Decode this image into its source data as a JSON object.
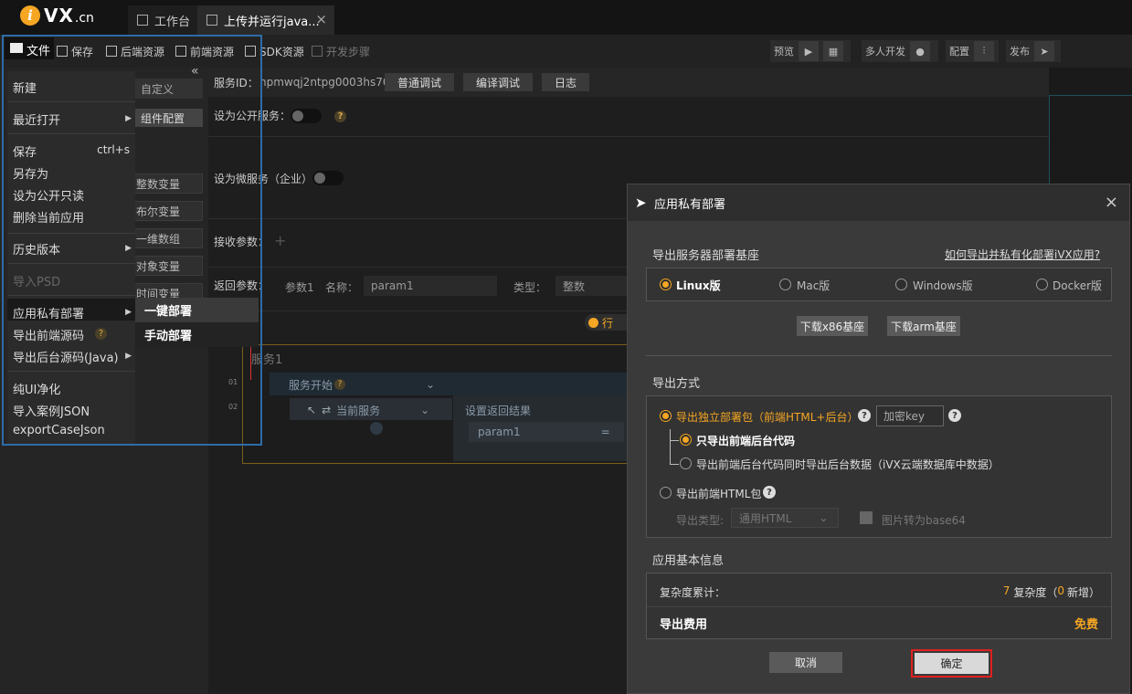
{
  "logo": {
    "brand": "VX",
    "suffix": ".cn",
    "mark": "i"
  },
  "tabs": {
    "workbench": "工作台",
    "upload": "上传并运行java...",
    "close": "×"
  },
  "toolbar": {
    "file": "文件",
    "save": "保存",
    "backend_res": "后端资源",
    "frontend_res": "前端资源",
    "sdk_res": "SDK资源",
    "dev_steps": "开发步骤",
    "preview": "预览",
    "multi_dev": "多人开发",
    "config": "配置",
    "publish": "发布"
  },
  "left_panel": {
    "collapse": "«",
    "custom": "自定义",
    "component_config": "组件配置",
    "vars": [
      "整数变量",
      "布尔变量",
      "一维数组",
      "对象变量",
      "时间变量"
    ]
  },
  "service": {
    "id_label": "服务ID：",
    "id_value": "npmwqj2ntpg0003hs70",
    "debug_normal": "普通调试",
    "debug_compile": "编译调试",
    "log": "日志",
    "public_label": "设为公开服务：",
    "micro_label": "设为微服务（企业）",
    "receive_label": "接收参数：",
    "return_label": "返回参数：",
    "param_index": "参数1",
    "name_label": "名称：",
    "name_value": "param1",
    "type_label": "类型：",
    "type_value": "整数",
    "run_toggle": "行"
  },
  "flow": {
    "title": "服务1",
    "line1": "01",
    "line2": "02",
    "start": "服务开始",
    "current": "当前服务",
    "set_result": "设置返回结果",
    "param": "param1",
    "eq": "="
  },
  "file_menu": {
    "new": "新建",
    "recent": "最近打开",
    "save": "保存",
    "save_shortcut": "ctrl+s",
    "save_as": "另存为",
    "set_public_readonly": "设为公开只读",
    "delete_app": "删除当前应用",
    "history": "历史版本",
    "import_psd": "导入PSD",
    "private_deploy": "应用私有部署",
    "export_frontend": "导出前端源码",
    "export_backend": "导出后台源码(Java)",
    "pure_ui": "纯UI净化",
    "import_case_json": "导入案例JSON",
    "export_case_json": "exportCaseJson",
    "submenu": {
      "one_click": "一键部署",
      "manual": "手动部署"
    }
  },
  "dialog": {
    "title": "应用私有部署",
    "close": "×",
    "base_section": "导出服务器部署基座",
    "help_link": "如何导出并私有化部署iVX应用?",
    "os_options": [
      "Linux版",
      "Mac版",
      "Windows版",
      "Docker版"
    ],
    "os_selected": "Linux版",
    "download_x86": "下载x86基座",
    "download_arm": "下载arm基座",
    "export_section": "导出方式",
    "standalone": "导出独立部署包（前端HTML+后台）",
    "key_placeholder": "加密key",
    "only_frontend_backend": "只导出前端后台代码",
    "with_data": "导出前端后台代码同时导出后台数据（iVX云端数据库中数据）",
    "html_only": "导出前端HTML包",
    "export_type_label": "导出类型:",
    "export_type_value": "通用HTML",
    "base64": "图片转为base64",
    "info_section": "应用基本信息",
    "complexity_label": "复杂度累计：",
    "complexity_value": "7",
    "complexity_unit": "复杂度（",
    "complexity_new": "0",
    "complexity_new_suffix": "新增）",
    "fee_label": "导出费用",
    "fee_value": "免费",
    "cancel": "取消",
    "confirm": "确定",
    "colors": {
      "accent": "#f5a623",
      "confirm_border": "#e02020"
    }
  }
}
